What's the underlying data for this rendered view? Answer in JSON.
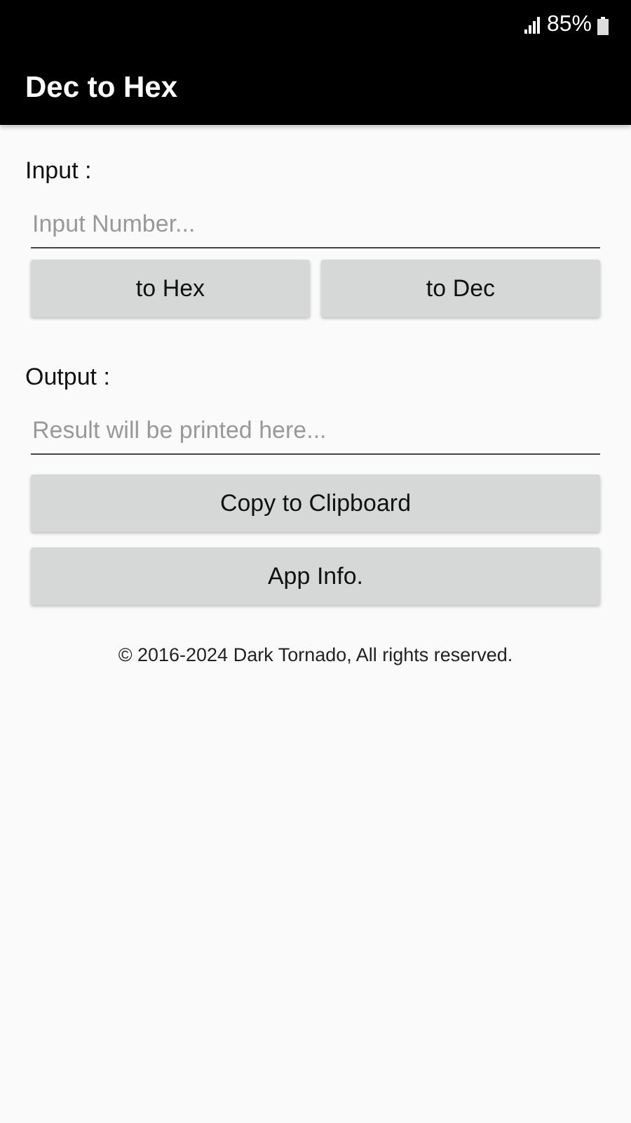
{
  "status_bar": {
    "battery": "85%"
  },
  "app_bar": {
    "title": "Dec to Hex"
  },
  "input": {
    "label": "Input :",
    "placeholder": "Input Number..."
  },
  "convert_buttons": [
    "to Hex",
    "to Dec"
  ],
  "output": {
    "label": "Output :",
    "placeholder": "Result will be printed here..."
  },
  "buttons": [
    "Copy to Clipboard",
    "App Info."
  ],
  "footer": "© 2016-2024 Dark Tornado, All rights reserved."
}
